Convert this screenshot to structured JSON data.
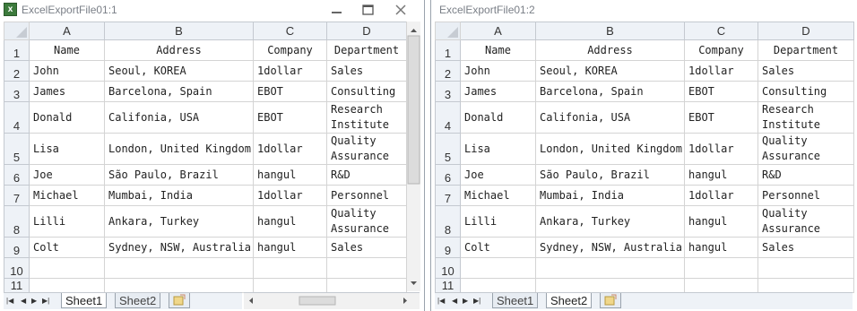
{
  "windows": [
    {
      "title": "ExcelExportFile01:1",
      "active_sheet": "Sheet1",
      "icon": "excel-app-icon"
    },
    {
      "title": "ExcelExportFile01:2",
      "active_sheet": "Sheet2",
      "icon": "none"
    }
  ],
  "columns": [
    "A",
    "B",
    "C",
    "D"
  ],
  "rows": [
    {
      "num": "1",
      "cells": [
        "Name",
        "Address",
        "Company",
        "Department"
      ],
      "header": true
    },
    {
      "num": "2",
      "cells": [
        "John",
        "Seoul, KOREA",
        "1dollar",
        "Sales"
      ]
    },
    {
      "num": "3",
      "cells": [
        "James",
        "Barcelona, Spain",
        "EBOT",
        "Consulting"
      ]
    },
    {
      "num": "4",
      "cells": [
        "Donald",
        "Califonia, USA",
        "EBOT",
        "Research Institute"
      ],
      "tall": true
    },
    {
      "num": "5",
      "cells": [
        "Lisa",
        "London, United Kingdom",
        "1dollar",
        "Quality Assurance"
      ],
      "tall": true
    },
    {
      "num": "6",
      "cells": [
        "Joe",
        "São Paulo, Brazil",
        "hangul",
        "R&D"
      ]
    },
    {
      "num": "7",
      "cells": [
        "Michael",
        "Mumbai, India",
        "1dollar",
        "Personnel"
      ]
    },
    {
      "num": "8",
      "cells": [
        "Lilli",
        "Ankara, Turkey",
        "hangul",
        "Quality Assurance"
      ],
      "tall": true
    },
    {
      "num": "9",
      "cells": [
        "Colt",
        "Sydney, NSW, Australia",
        "hangul",
        "Sales"
      ]
    },
    {
      "num": "10",
      "cells": [
        "",
        "",
        "",
        ""
      ]
    },
    {
      "num": "11",
      "cells": [
        "",
        "",
        "",
        ""
      ]
    }
  ],
  "sheet_tabs": [
    "Sheet1",
    "Sheet2"
  ],
  "colors": {
    "header_bg": "#eef2f7",
    "grid_line": "#d4d4d4",
    "title_text": "#7a7f87",
    "window_border": "#9aa3ad"
  }
}
